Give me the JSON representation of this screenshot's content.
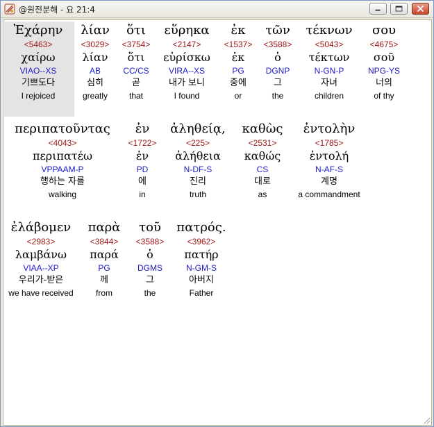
{
  "window": {
    "title": "@원전분해 - 요 21:4",
    "buttons": [
      "minimize",
      "maximize",
      "close"
    ]
  },
  "rows": [
    [
      {
        "greek": "Ἐχάρην",
        "strong": "<5463>",
        "lemma": "χαίρω",
        "parse": "VIAO--XS",
        "korean": "기쁘도다",
        "english": "I rejoiced"
      },
      {
        "greek": "λίαν",
        "strong": "<3029>",
        "lemma": "λίαν",
        "parse": "AB",
        "korean": "심히",
        "english": "greatly"
      },
      {
        "greek": "ὅτι",
        "strong": "<3754>",
        "lemma": "ὅτι",
        "parse": "CC/CS",
        "korean": "곧",
        "english": "that"
      },
      {
        "greek": "εὕρηκα",
        "strong": "<2147>",
        "lemma": "εὑρίσκω",
        "parse": "VIRA--XS",
        "korean": "내가 보니",
        "english": "I found"
      },
      {
        "greek": "ἐκ",
        "strong": "<1537>",
        "lemma": "ἐκ",
        "parse": "PG",
        "korean": "중에",
        "english": "or"
      },
      {
        "greek": "τῶν",
        "strong": "<3588>",
        "lemma": "ὁ",
        "parse": "DGNP",
        "korean": "그",
        "english": "the"
      },
      {
        "greek": "τέκνων",
        "strong": "<5043>",
        "lemma": "τέκτων",
        "parse": "N-GN-P",
        "korean": "자녀",
        "english": "children"
      },
      {
        "greek": "σου",
        "strong": "<4675>",
        "lemma": "σοῦ",
        "parse": "NPG-YS",
        "korean": "너의",
        "english": "of thy"
      }
    ],
    [
      {
        "greek": "περιπατοῦντας",
        "strong": "<4043>",
        "lemma": "περιπατέω",
        "parse": "VPPAAM-P",
        "korean": "행하는 자를",
        "english": "walking"
      },
      {
        "greek": "ἐν",
        "strong": "<1722>",
        "lemma": "ἐν",
        "parse": "PD",
        "korean": "에",
        "english": "in"
      },
      {
        "greek": "ἀληθείᾳ,",
        "strong": "<225>",
        "lemma": "ἀλήθεια",
        "parse": "N-DF-S",
        "korean": "진리",
        "english": "truth"
      },
      {
        "greek": "καθὼς",
        "strong": "<2531>",
        "lemma": "καθώς",
        "parse": "CS",
        "korean": "대로",
        "english": "as"
      },
      {
        "greek": "ἐντολὴν",
        "strong": "<1785>",
        "lemma": "ἐντολή",
        "parse": "N-AF-S",
        "korean": "계명",
        "english": "a commandment"
      }
    ],
    [
      {
        "greek": "ἐλάβομεν",
        "strong": "<2983>",
        "lemma": "λαμβάνω",
        "parse": "VIAA--XP",
        "korean": "우리가-받은",
        "english": "we have received"
      },
      {
        "greek": "παρὰ",
        "strong": "<3844>",
        "lemma": "παρά",
        "parse": "PG",
        "korean": "께",
        "english": "from"
      },
      {
        "greek": "τοῦ",
        "strong": "<3588>",
        "lemma": "ὁ",
        "parse": "DGMS",
        "korean": "그",
        "english": "the"
      },
      {
        "greek": "πατρός.",
        "strong": "<3962>",
        "lemma": "πατήρ",
        "parse": "N-GM-S",
        "korean": "아버지",
        "english": "Father"
      }
    ]
  ]
}
